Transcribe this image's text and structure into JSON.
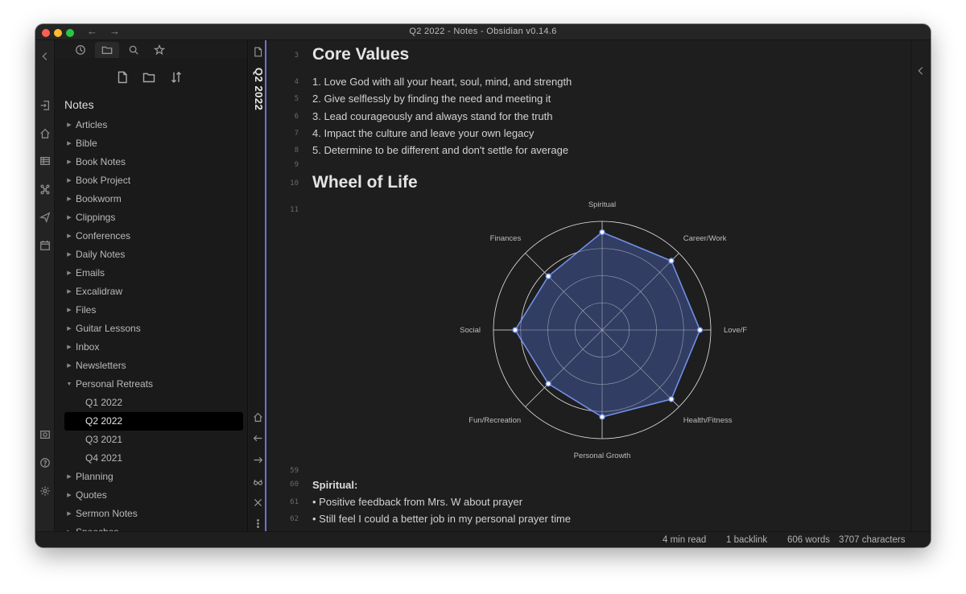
{
  "window": {
    "title": "Q2 2022 - Notes - Obsidian v0.14.6"
  },
  "nav": {
    "back": "←",
    "forward": "→"
  },
  "sidebar": {
    "vault_name": "Notes",
    "folders": [
      {
        "label": "Articles",
        "caret": "▶"
      },
      {
        "label": "Bible",
        "caret": "▶"
      },
      {
        "label": "Book Notes",
        "caret": "▶"
      },
      {
        "label": "Book Project",
        "caret": "▶"
      },
      {
        "label": "Bookworm",
        "caret": "▶"
      },
      {
        "label": "Clippings",
        "caret": "▶"
      },
      {
        "label": "Conferences",
        "caret": "▶"
      },
      {
        "label": "Daily Notes",
        "caret": "▶"
      },
      {
        "label": "Emails",
        "caret": "▶"
      },
      {
        "label": "Excalidraw",
        "caret": "▶"
      },
      {
        "label": "Files",
        "caret": "▶"
      },
      {
        "label": "Guitar Lessons",
        "caret": "▶"
      },
      {
        "label": "Inbox",
        "caret": "▶"
      },
      {
        "label": "Newsletters",
        "caret": "▶"
      },
      {
        "label": "Personal Retreats",
        "caret": "▼"
      },
      {
        "label": "Q1 2022",
        "caret": ""
      },
      {
        "label": "Q2 2022",
        "caret": ""
      },
      {
        "label": "Q3 2021",
        "caret": ""
      },
      {
        "label": "Q4 2021",
        "caret": ""
      },
      {
        "label": "Planning",
        "caret": "▶"
      },
      {
        "label": "Quotes",
        "caret": "▶"
      },
      {
        "label": "Sermon Notes",
        "caret": "▶"
      },
      {
        "label": "Speeches",
        "caret": "▶"
      }
    ]
  },
  "view": {
    "title": "Q2 2022"
  },
  "editor": {
    "line_numbers": [
      "3",
      "4",
      "5",
      "6",
      "7",
      "8",
      "9",
      "10",
      "11",
      "59",
      "60",
      "61",
      "62"
    ],
    "heading_core_values": "Core Values",
    "core_values": [
      "1. Love God with all your heart, soul, mind, and strength",
      "2. Give selflessly by finding the need and meeting it",
      "3. Lead courageously and always stand for the truth",
      "4. Impact the culture and leave your own legacy",
      "5. Determine to be different and don't settle for average"
    ],
    "heading_wheel": "Wheel of Life",
    "spiritual_heading": "Spiritual:",
    "spiritual_items": [
      "• Positive feedback from Mrs. W about prayer",
      "• Still feel I could a better job in my personal prayer time"
    ]
  },
  "chart_data": {
    "type": "radar",
    "categories": [
      "Spiritual",
      "Career/Work",
      "Love/Family",
      "Health/Fitness",
      "Personal Growth",
      "Fun/Recreation",
      "Social",
      "Finances"
    ],
    "values": [
      9,
      9,
      9,
      9,
      8,
      7,
      8,
      7
    ],
    "rmax": 10,
    "grid_rings": 4,
    "fill_color": "#34406a",
    "line_color": "#6f8fe8"
  },
  "status": {
    "read_time": "4 min read",
    "backlinks": "1 backlink",
    "words": "606 words",
    "characters": "3707 characters"
  },
  "colors": {
    "accent": "#6c70d8"
  }
}
